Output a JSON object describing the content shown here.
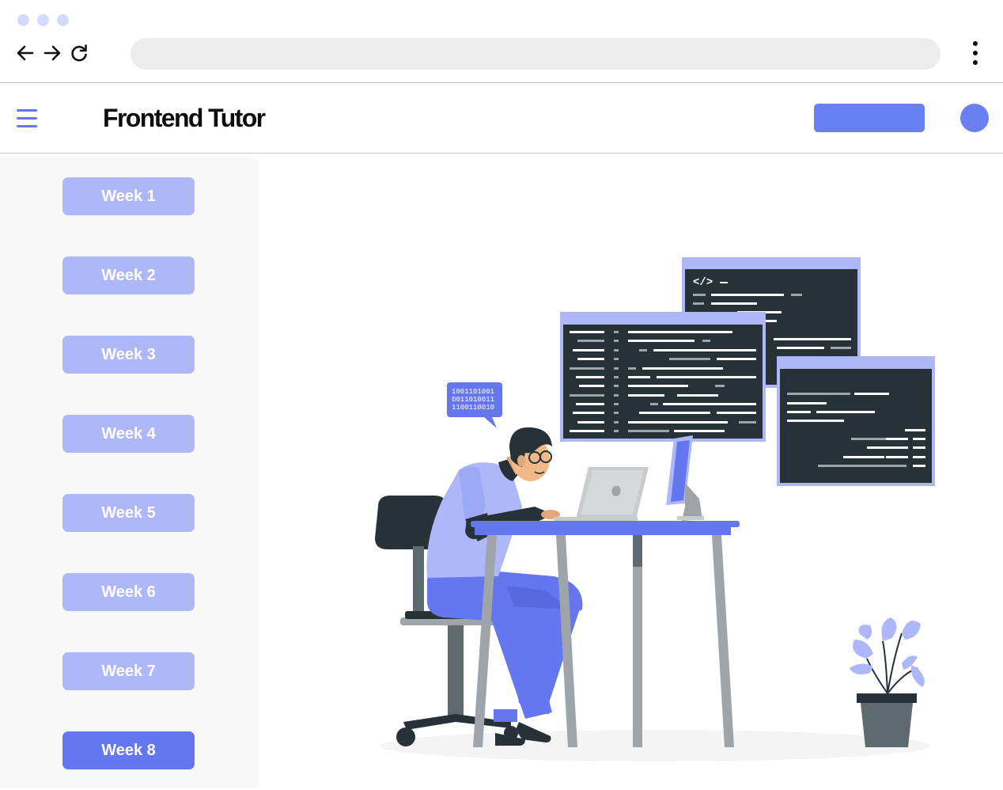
{
  "header": {
    "brand": "Frontend Tutor"
  },
  "sidebar": {
    "weeks": [
      {
        "label": "Week 1"
      },
      {
        "label": "Week 2"
      },
      {
        "label": "Week 3"
      },
      {
        "label": "Week 4"
      },
      {
        "label": "Week 5"
      },
      {
        "label": "Week 6"
      },
      {
        "label": "Week 7"
      },
      {
        "label": "Week 8"
      }
    ],
    "active_week": "Week 8"
  },
  "illustration": {
    "bubble_lines": [
      "1001101001",
      "0011010011",
      "1100110010"
    ],
    "code_tag": "</>"
  },
  "colors": {
    "accent": "#6577ee",
    "button_light": "#aeb8f8",
    "code_window": "#263238",
    "sidebar_bg": "#f8f8f8"
  }
}
